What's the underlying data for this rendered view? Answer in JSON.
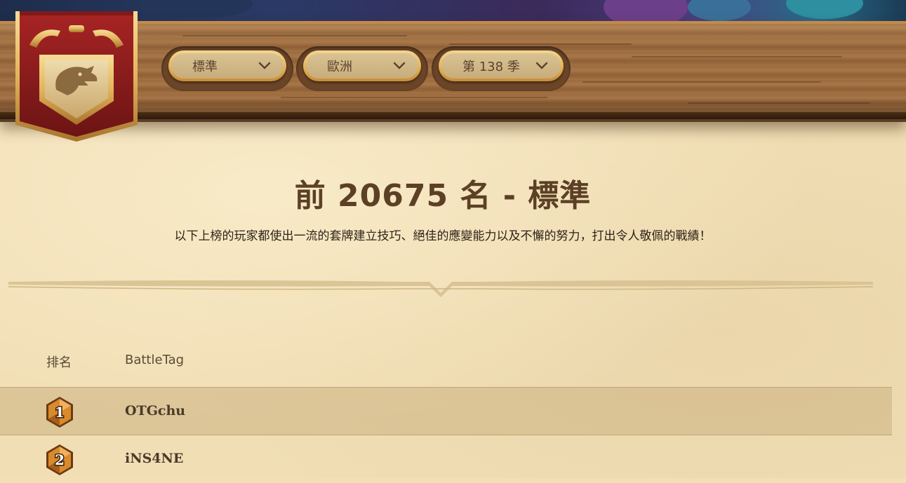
{
  "filters": {
    "mode": "標準",
    "region": "歐洲",
    "season": "第 138 季"
  },
  "header": {
    "title": "前 20675 名 - 標準",
    "subtitle": "以下上榜的玩家都使出一流的套牌建立技巧、絕佳的應變能力以及不懈的努力，打出令人敬佩的戰績！"
  },
  "table": {
    "columns": {
      "rank": "排名",
      "battletag": "BattleTag"
    },
    "rows": [
      {
        "rank": "1",
        "battletag": "OTGchu"
      },
      {
        "rank": "2",
        "battletag": "iNS4NE"
      }
    ]
  },
  "icons": {
    "crest": "dragon-crest-icon",
    "dropdown": "chevron-down-icon",
    "rank": "legend-rank-gem-icon"
  },
  "colors": {
    "plank": "#9c6b40",
    "parchment": "#f1deb5",
    "title": "#5c4026",
    "banner_red": "#8e1f1f",
    "gold": "#e7b75e"
  }
}
